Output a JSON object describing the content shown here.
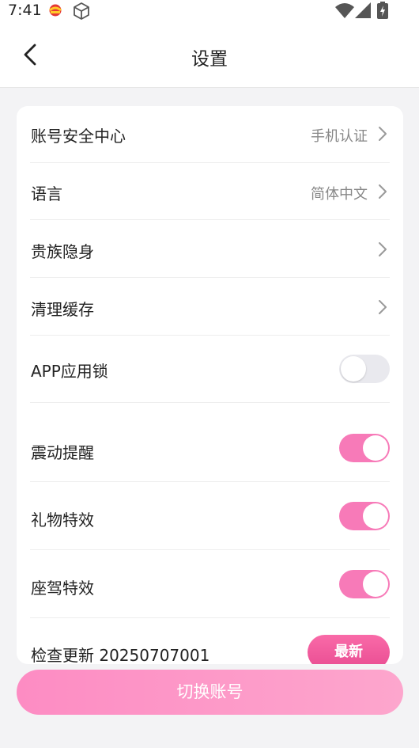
{
  "status_bar": {
    "time": "7:41",
    "icons": [
      "app-notification-icon",
      "cube-icon",
      "wifi-icon",
      "signal-icon",
      "battery-icon"
    ]
  },
  "header": {
    "title": "设置",
    "back_icon": "chevron-left-icon"
  },
  "settings": {
    "account_security": {
      "label": "账号安全中心",
      "value": "手机认证"
    },
    "language": {
      "label": "语言",
      "value": "简体中文"
    },
    "noble_invisible": {
      "label": "贵族隐身"
    },
    "clear_cache": {
      "label": "清理缓存"
    },
    "app_lock": {
      "label": "APP应用锁",
      "enabled": false
    },
    "vibration": {
      "label": "震动提醒",
      "enabled": true
    },
    "gift_effects": {
      "label": "礼物特效",
      "enabled": true
    },
    "mount_effects": {
      "label": "座驾特效",
      "enabled": true
    },
    "check_update": {
      "label": "检查更新 20250707001",
      "badge": "最新"
    }
  },
  "footer": {
    "switch_account_label": "切换账号"
  },
  "colors": {
    "accent": "#f77ab8",
    "switch_off": "#e9e9ee",
    "background": "#f3f3f5"
  }
}
